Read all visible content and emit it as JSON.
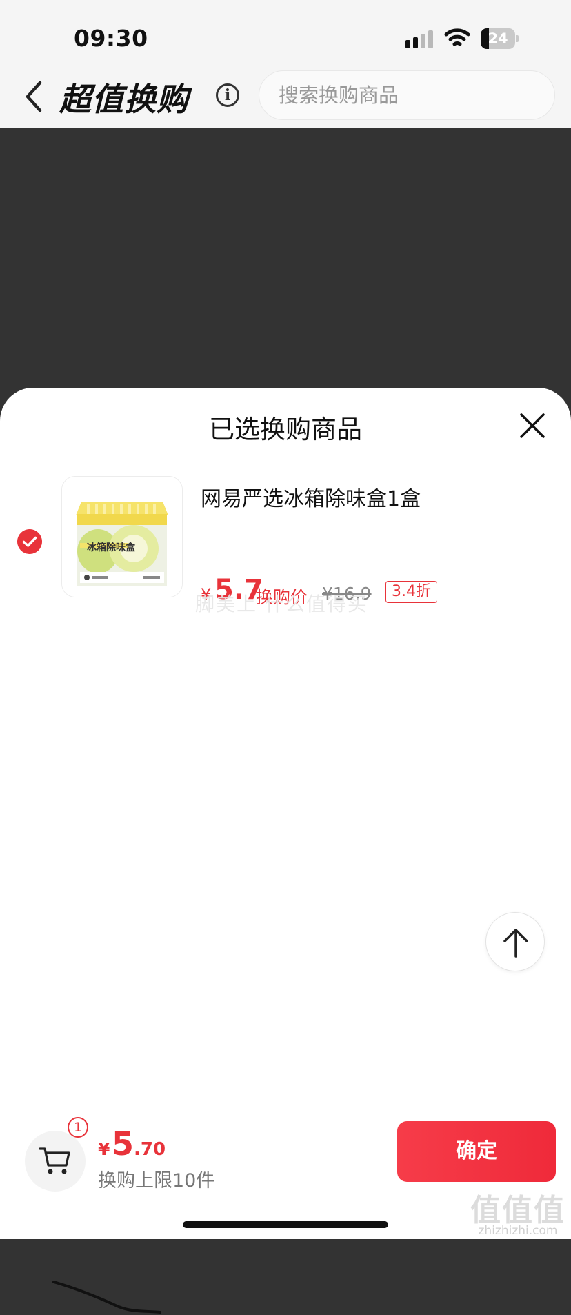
{
  "status_bar": {
    "time": "09:30",
    "battery_level": "24",
    "battery_fraction": 0.24,
    "signal_icon": "cellular-signal-icon",
    "wifi_icon": "wifi-icon"
  },
  "nav": {
    "back_icon": "chevron-left-icon",
    "title": "超值换购",
    "info_symbol": "i",
    "search_placeholder": "搜索换购商品"
  },
  "sheet": {
    "title": "已选换购商品",
    "close_icon": "close-icon",
    "items": [
      {
        "selected": true,
        "check_icon": "check-circle-icon",
        "thumbnail_label": "冰箱除味盒",
        "name": "网易严选冰箱除味盒1盒",
        "currency": "¥",
        "price": "5.7",
        "price_label": "换购价",
        "original_price": "¥16.9",
        "discount": "3.4折"
      }
    ],
    "watermark": "脚美上 什么值得买"
  },
  "scroll_top_icon": "arrow-up-icon",
  "footer": {
    "cart_icon": "shopping-cart-icon",
    "cart_count": "1",
    "total_currency": "¥",
    "total_integer": "5",
    "total_decimal": ".70",
    "limit_text": "换购上限10件",
    "confirm_label": "确定"
  },
  "corner_watermark": {
    "text": "zhizhizhi.com",
    "logo": "值值值"
  },
  "colors": {
    "accent": "#e8333a",
    "overlay": "#333333",
    "topbar": "#f5f5f5"
  }
}
